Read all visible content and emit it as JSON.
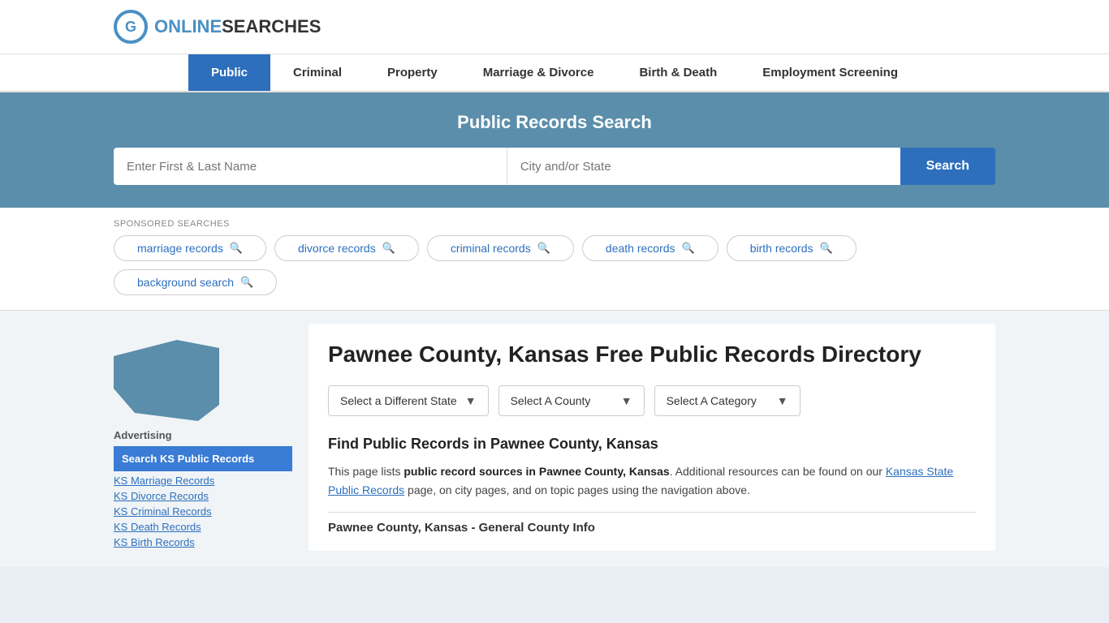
{
  "header": {
    "logo_text_plain": "ONLINE",
    "logo_text_colored": "SEARCHES"
  },
  "nav": {
    "items": [
      {
        "label": "Public",
        "active": true
      },
      {
        "label": "Criminal",
        "active": false
      },
      {
        "label": "Property",
        "active": false
      },
      {
        "label": "Marriage & Divorce",
        "active": false
      },
      {
        "label": "Birth & Death",
        "active": false
      },
      {
        "label": "Employment Screening",
        "active": false
      }
    ]
  },
  "search_banner": {
    "title": "Public Records Search",
    "name_placeholder": "Enter First & Last Name",
    "location_placeholder": "City and/or State",
    "button_label": "Search"
  },
  "sponsored": {
    "label": "SPONSORED SEARCHES",
    "pills": [
      {
        "label": "marriage records"
      },
      {
        "label": "divorce records"
      },
      {
        "label": "criminal records"
      },
      {
        "label": "death records"
      },
      {
        "label": "birth records"
      },
      {
        "label": "background search"
      }
    ]
  },
  "sidebar": {
    "ad_label": "Advertising",
    "ad_active_label": "Search KS Public Records",
    "links": [
      {
        "label": "KS Marriage Records"
      },
      {
        "label": "KS Divorce Records"
      },
      {
        "label": "KS Criminal Records"
      },
      {
        "label": "KS Death Records"
      },
      {
        "label": "KS Birth Records"
      }
    ]
  },
  "main": {
    "page_title": "Pawnee County, Kansas Free Public Records Directory",
    "dropdowns": {
      "state_label": "Select a Different State",
      "county_label": "Select A County",
      "category_label": "Select A Category"
    },
    "section_title": "Find Public Records in Pawnee County, Kansas",
    "body_text_1": "This page lists ",
    "body_text_bold": "public record sources in Pawnee County, Kansas",
    "body_text_2": ". Additional resources can be found on our ",
    "body_link": "Kansas State Public Records",
    "body_text_3": " page, on city pages, and on topic pages using the navigation above.",
    "county_info_title": "Pawnee County, Kansas - General County Info"
  }
}
